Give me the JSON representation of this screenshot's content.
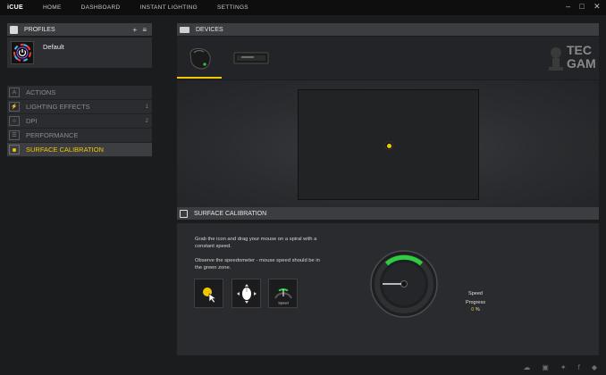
{
  "app": {
    "brand": "iCUE"
  },
  "nav": {
    "items": [
      "HOME",
      "DASHBOARD",
      "INSTANT LIGHTING",
      "SETTINGS"
    ]
  },
  "window_controls": {
    "minimize": "–",
    "maximize": "□",
    "close": "✕"
  },
  "profiles": {
    "title": "PROFILES",
    "actions": "+ ≡",
    "active_profile": "Default"
  },
  "left_menu": [
    {
      "label": "ACTIONS",
      "icon": "A",
      "count": ""
    },
    {
      "label": "LIGHTING EFFECTS",
      "icon": "⚡",
      "count": "1"
    },
    {
      "label": "DPI",
      "icon": "⊹",
      "count": "2"
    },
    {
      "label": "PERFORMANCE",
      "icon": "☰",
      "count": ""
    },
    {
      "label": "SURFACE CALIBRATION",
      "icon": "",
      "count": "",
      "active": true
    }
  ],
  "devices": {
    "title": "DEVICES",
    "items": [
      {
        "name": "mouse-device",
        "selected": true
      },
      {
        "name": "keyboard-device",
        "selected": false
      }
    ]
  },
  "watermark": {
    "line1": "TEC",
    "line2": "GAM"
  },
  "calibration": {
    "title": "SURFACE CALIBRATION",
    "instruction1": "Grab the icon and drag your mouse on a spiral with a constant speed.",
    "instruction2": "Observe the speedometer - mouse speed should be in the green zone.",
    "tool_speed_label": "Speed",
    "gauge_speed_label": "Speed",
    "progress_label": "Progress",
    "progress_value": "0",
    "progress_unit": "%"
  },
  "colors": {
    "accent": "#f0c800",
    "green_zone": "#2ecc40"
  },
  "footer_icons": [
    "cloud-icon",
    "gift-icon",
    "twitter-icon",
    "facebook-icon",
    "forum-icon"
  ]
}
